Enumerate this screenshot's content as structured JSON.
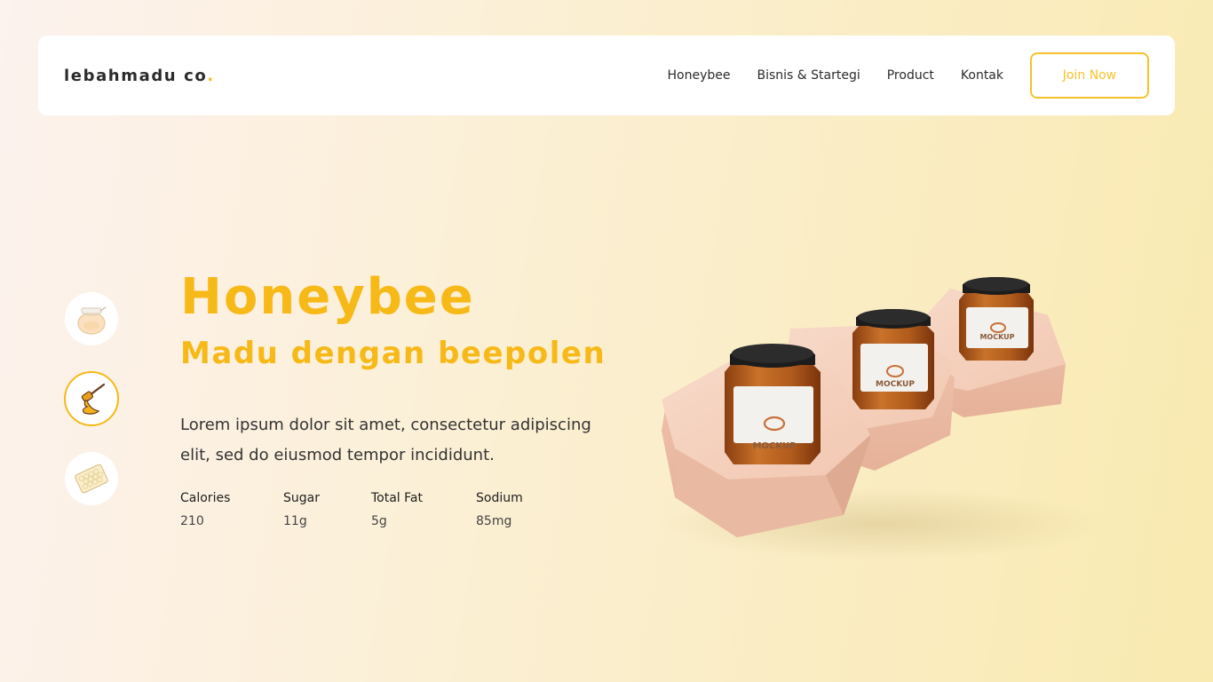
{
  "brand": {
    "name": "lebahmadu co",
    "dot": "."
  },
  "nav": {
    "links": [
      "Honeybee",
      "Bisnis & Startegi",
      "Product",
      "Kontak"
    ],
    "cta": "Join Now"
  },
  "thumbs": [
    {
      "icon": "honey-jar-icon",
      "active": false
    },
    {
      "icon": "honey-dipper-icon",
      "active": true
    },
    {
      "icon": "honeycomb-icon",
      "active": false
    }
  ],
  "hero": {
    "title": "Honeybee",
    "subtitle": "Madu dengan beepolen",
    "description": "Lorem ipsum dolor sit amet, consectetur adipiscing elit, sed do eiusmod tempor incididunt."
  },
  "nutrition": [
    {
      "label": "Calories",
      "value": "210"
    },
    {
      "label": "Sugar",
      "value": "11g"
    },
    {
      "label": "Total Fat",
      "value": "5g"
    },
    {
      "label": "Sodium",
      "value": "85mg"
    }
  ],
  "product_image": {
    "jar_label": "MOCKUP"
  },
  "colors": {
    "accent": "#f7b918",
    "jar_honey": "#b9651e",
    "pedestal": "#f5cdb8"
  }
}
